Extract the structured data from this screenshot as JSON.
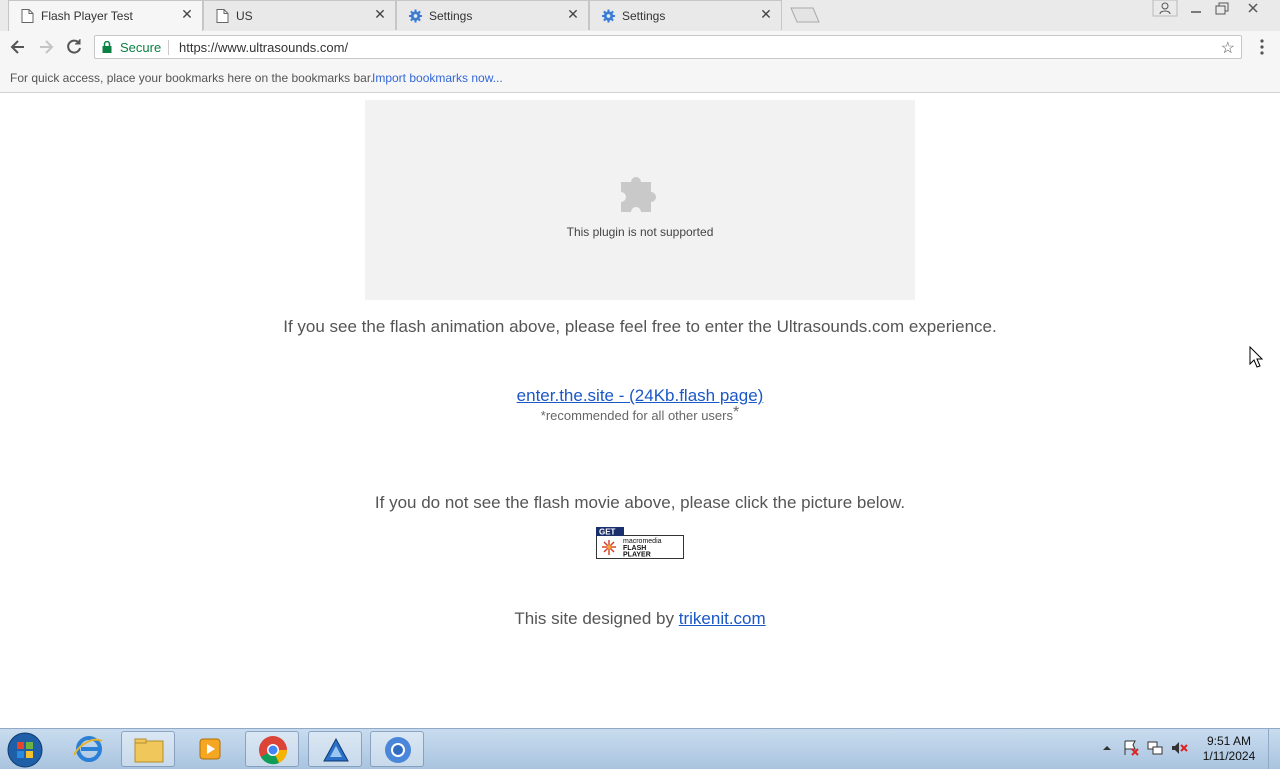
{
  "tabs": [
    {
      "title": "Flash Player Test",
      "icon": "page-icon",
      "active": true
    },
    {
      "title": "US",
      "icon": "page-icon",
      "active": false
    },
    {
      "title": "Settings",
      "icon": "gear-icon",
      "active": false
    },
    {
      "title": "Settings",
      "icon": "gear-icon",
      "active": false
    }
  ],
  "toolbar": {
    "secure_label": "Secure",
    "url": "https://www.ultrasounds.com/"
  },
  "bookmarks_bar": {
    "text": "For quick access, place your bookmarks here on the bookmarks bar.",
    "link": "Import bookmarks now..."
  },
  "page": {
    "plugin_message": "This plugin is not supported",
    "intro": "If you see the flash animation above, please feel free to enter the Ultrasounds.com experience.",
    "enter_link": "enter.the.site - (24Kb.flash page)",
    "recommended": "*recommended for all other users",
    "no_flash": "If you do not see the flash movie above, please click the picture below.",
    "badge_get": "GET",
    "badge_line1": "macromedia",
    "badge_line2": "FLASH",
    "badge_line3": "PLAYER",
    "designed_by": "This site designed by",
    "designer_link": "trikenit.com"
  },
  "taskbar": {
    "time": "9:51 AM",
    "date": "1/11/2024"
  },
  "colors": {
    "link": "#1a57c7",
    "secure": "#0b8043",
    "plugin_bg": "#f2f2f2"
  }
}
